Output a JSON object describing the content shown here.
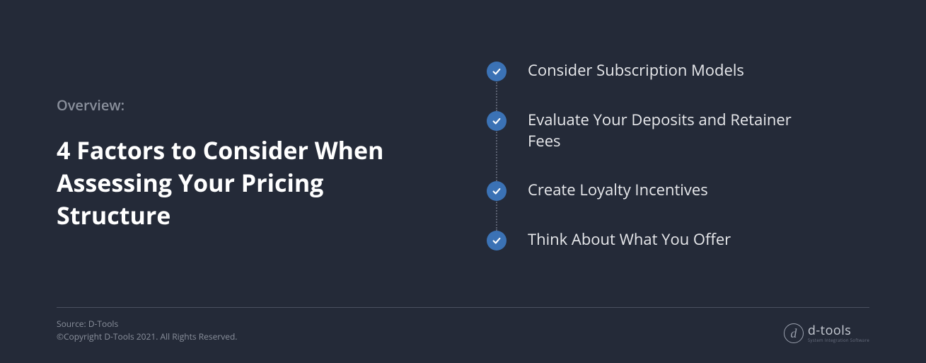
{
  "overview_label": "Overview:",
  "title": "4 Factors to Consider When Assessing Your Pricing Structure",
  "factors": [
    {
      "text": "Consider Subscription Models"
    },
    {
      "text": "Evaluate Your Deposits and Retainer Fees"
    },
    {
      "text": "Create Loyalty Incentives"
    },
    {
      "text": "Think About What You Offer"
    }
  ],
  "footer": {
    "source": "Source: D-Tools",
    "copyright": "©Copyright D-Tools 2021. All Rights Reserved."
  },
  "logo": {
    "letter": "d",
    "brand": "d-tools",
    "tagline": "System Integration Software"
  }
}
